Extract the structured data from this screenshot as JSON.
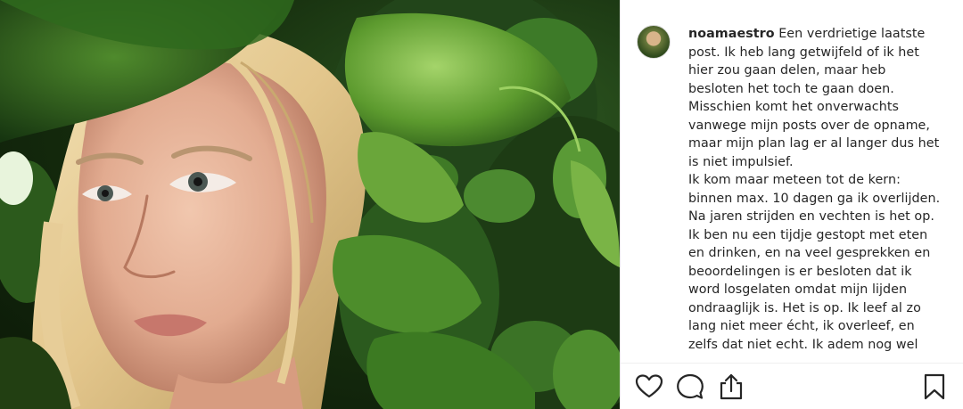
{
  "post": {
    "username": "noamaestro",
    "caption_lines": [
      "Een verdrietige laatste",
      "post. Ik heb lang getwijfeld of ik het",
      "hier zou gaan delen, maar heb",
      "besloten het toch te gaan doen.",
      "Misschien komt het onverwachts",
      "vanwege mijn posts over de opname,",
      "maar mijn plan lag er al langer dus het",
      "is niet impulsief.",
      "Ik kom maar meteen tot de kern:",
      "binnen max. 10 dagen ga ik overlijden.",
      "Na jaren strijden en vechten is het op.",
      "Ik ben nu een tijdje gestopt met eten",
      "en drinken, en na veel gesprekken en",
      "beoordelingen is er besloten dat ik",
      "word losgelaten omdat mijn lijden",
      "ondraaglijk is. Het is op. Ik leef al zo",
      "lang niet meer écht, ik overleef, en",
      "zelfs dat niet echt. Ik adem nog wel"
    ]
  },
  "actions": {
    "like_icon": "heart-outline-icon",
    "comment_icon": "comment-bubble-icon",
    "share_icon": "share-upload-icon",
    "save_icon": "bookmark-icon"
  },
  "colors": {
    "text": "#262626",
    "leaf_dark": "#17300f",
    "leaf_light": "#7fb84a",
    "skin": "#e9b9a0",
    "hair": "#e8cf9a"
  }
}
